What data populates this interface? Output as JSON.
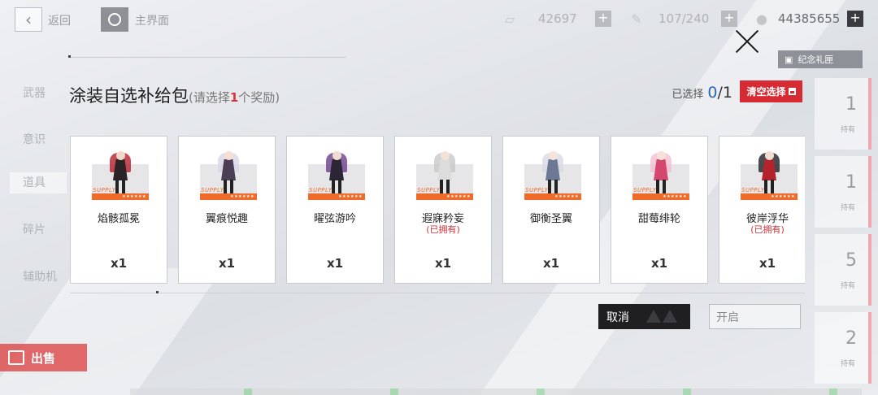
{
  "topbar": {
    "back_label": "返回",
    "home_label": "主界面",
    "resources": [
      {
        "icon": "card-ticket-icon",
        "value": "42697"
      },
      {
        "icon": "stamina-syringe-icon",
        "value": "107/240"
      },
      {
        "icon": "gem-coin-icon",
        "value": "44385655"
      }
    ]
  },
  "sidebar": {
    "items": [
      {
        "label": "武器"
      },
      {
        "label": "意识"
      },
      {
        "label": "道具"
      },
      {
        "label": "碎片"
      },
      {
        "label": "辅助机"
      }
    ]
  },
  "sell_label": "出售",
  "souvenir_label": "纪念礼匣",
  "right_cards": [
    {
      "count": "1",
      "owned": "持有"
    },
    {
      "count": "1",
      "owned": "持有"
    },
    {
      "count": "5",
      "owned": "持有"
    },
    {
      "count": "2",
      "owned": "持有"
    }
  ],
  "dialog": {
    "title": "涂装自选补给包",
    "hint_prefix": "(请选择",
    "hint_num": "1",
    "hint_suffix": "个奖励)",
    "selected_label": "已选择",
    "selected_current": "0",
    "selected_total": "/1",
    "clear_label": "清空选择",
    "cancel_label": "取消",
    "open_label": "开启",
    "supply_badge": "SUPPLY",
    "stars": "★★★★★★",
    "items": [
      {
        "name": "焰骸孤冕",
        "owned": "",
        "qty": "x1",
        "colors": {
          "hair": "#b51f2a",
          "body": "#2b2326",
          "head": "#f1d7c9"
        }
      },
      {
        "name": "翼痕悦趣",
        "owned": "",
        "qty": "x1",
        "colors": {
          "hair": "#d9d6e6",
          "body": "#4a3f55",
          "head": "#f3dfd6"
        }
      },
      {
        "name": "曜弦游吟",
        "owned": "",
        "qty": "x1",
        "colors": {
          "hair": "#6b3d8c",
          "body": "#2c2535",
          "head": "#f0dcd0"
        }
      },
      {
        "name": "遐寐矜妄",
        "owned": "(已拥有)",
        "qty": "x1",
        "colors": {
          "hair": "#c8c8c8",
          "body": "#dcdcdc",
          "head": "#f2e2d8"
        }
      },
      {
        "name": "御衡圣翼",
        "owned": "",
        "qty": "x1",
        "colors": {
          "hair": "#d7dbe5",
          "body": "#6c7894",
          "head": "#f4e4da"
        }
      },
      {
        "name": "甜莓绯轮",
        "owned": "",
        "qty": "x1",
        "colors": {
          "hair": "#f1bfd1",
          "body": "#d6476f",
          "head": "#f6e1d8"
        }
      },
      {
        "name": "彼岸浮华",
        "owned": "(已拥有)",
        "qty": "x1",
        "colors": {
          "hair": "#1f1f24",
          "body": "#b4232c",
          "head": "#f1ddd2"
        }
      }
    ]
  }
}
